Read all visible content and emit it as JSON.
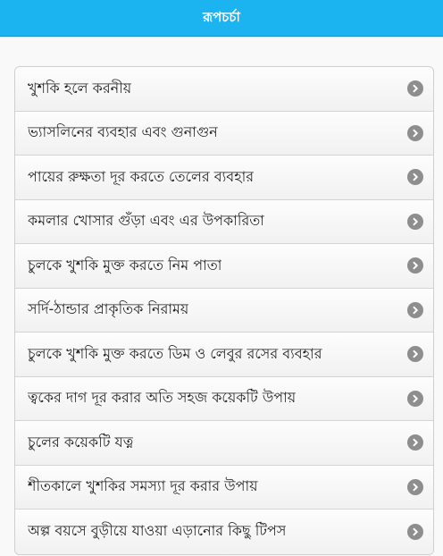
{
  "header": {
    "title": "রূপচর্চা"
  },
  "list": {
    "items": [
      {
        "label": "খুশকি হলে করনীয়"
      },
      {
        "label": "ভ্যাসলিনের ব্যবহার এবং গুনাগুন"
      },
      {
        "label": "পায়ের রুক্ষতা দূর করতে তেলের ব্যবহার"
      },
      {
        "label": "কমলার খোসার গুঁড়া এবং এর উপকারিতা"
      },
      {
        "label": "চুলকে খুশকি মুক্ত করতে নিম পাতা"
      },
      {
        "label": "সর্দি-ঠান্ডার প্রাকৃতিক নিরাময়"
      },
      {
        "label": "চুলকে খুশকি মুক্ত করতে ডিম ও লেবুর রসের ব্যবহার"
      },
      {
        "label": "ত্বকের দাগ দূর করার অতি সহজ কয়েকটি উপায়"
      },
      {
        "label": "চুলের কয়েকটি যত্ন"
      },
      {
        "label": "শীতকালে খুশকির সমস্যা দূর করার উপায়"
      },
      {
        "label": "অল্প বয়সে বুড়ীয়ে যাওয়া এড়ানোর কিছু টিপস"
      }
    ],
    "item_icon": "chevron-right-circle-icon"
  }
}
